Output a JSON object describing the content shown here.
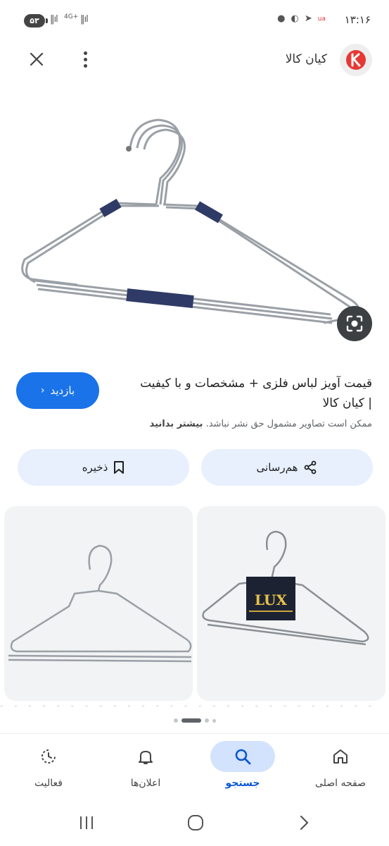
{
  "status_bar": {
    "battery": "۵۳",
    "network": "4G+",
    "time": "۱۳:۱۶"
  },
  "top_bar": {
    "site_name": "کیان کالا",
    "logo_letter": "K"
  },
  "result": {
    "title": "قیمت آویز لباس فلزی + مشخصات و با کیفیت | کیان کالا",
    "visit_label": "بازدید",
    "copyright_notice": "ممکن است تصاویر مشمول حق نشر نباشد.",
    "learn_more": "بیشتر بدانید",
    "share_label": "هم‌رسانی",
    "save_label": "ذخیره"
  },
  "related": {
    "card_right_brand": "LUX"
  },
  "bottom_nav": {
    "items": [
      {
        "label": "صفحه اصلی",
        "icon": "home-icon"
      },
      {
        "label": "جستجو",
        "icon": "search-icon",
        "active": true
      },
      {
        "label": "اعلان‌ها",
        "icon": "bell-icon"
      },
      {
        "label": "فعالیت",
        "icon": "activity-icon"
      }
    ]
  },
  "colors": {
    "accent": "#1a73e8",
    "tonal": "#e8f0fe",
    "active_nav": "#d3e3fd"
  }
}
